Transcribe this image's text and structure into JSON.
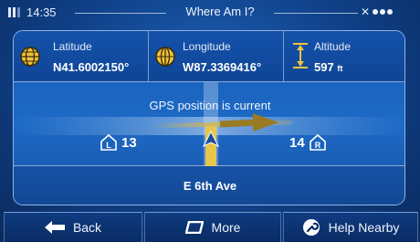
{
  "statusbar": {
    "time": "14:35",
    "title": "Where Am I?"
  },
  "coords": {
    "latitude_label": "Latitude",
    "latitude_value": "N41.6002150°",
    "longitude_label": "Longitude",
    "longitude_value": "W87.3369416°",
    "altitude_label": "Altitude",
    "altitude_value": "597",
    "altitude_unit": "ft"
  },
  "road": {
    "gps_message": "GPS position is current",
    "left_house_letter": "L",
    "left_house_number": "13",
    "right_house_letter": "R",
    "right_house_number": "14"
  },
  "street_name": "E 6th Ave",
  "buttons": {
    "back": "Back",
    "more": "More",
    "help_nearby": "Help Nearby"
  },
  "colors": {
    "road": "#e8c64a",
    "arrow": "#9a7a22",
    "position_marker": "#1a4d9c"
  }
}
